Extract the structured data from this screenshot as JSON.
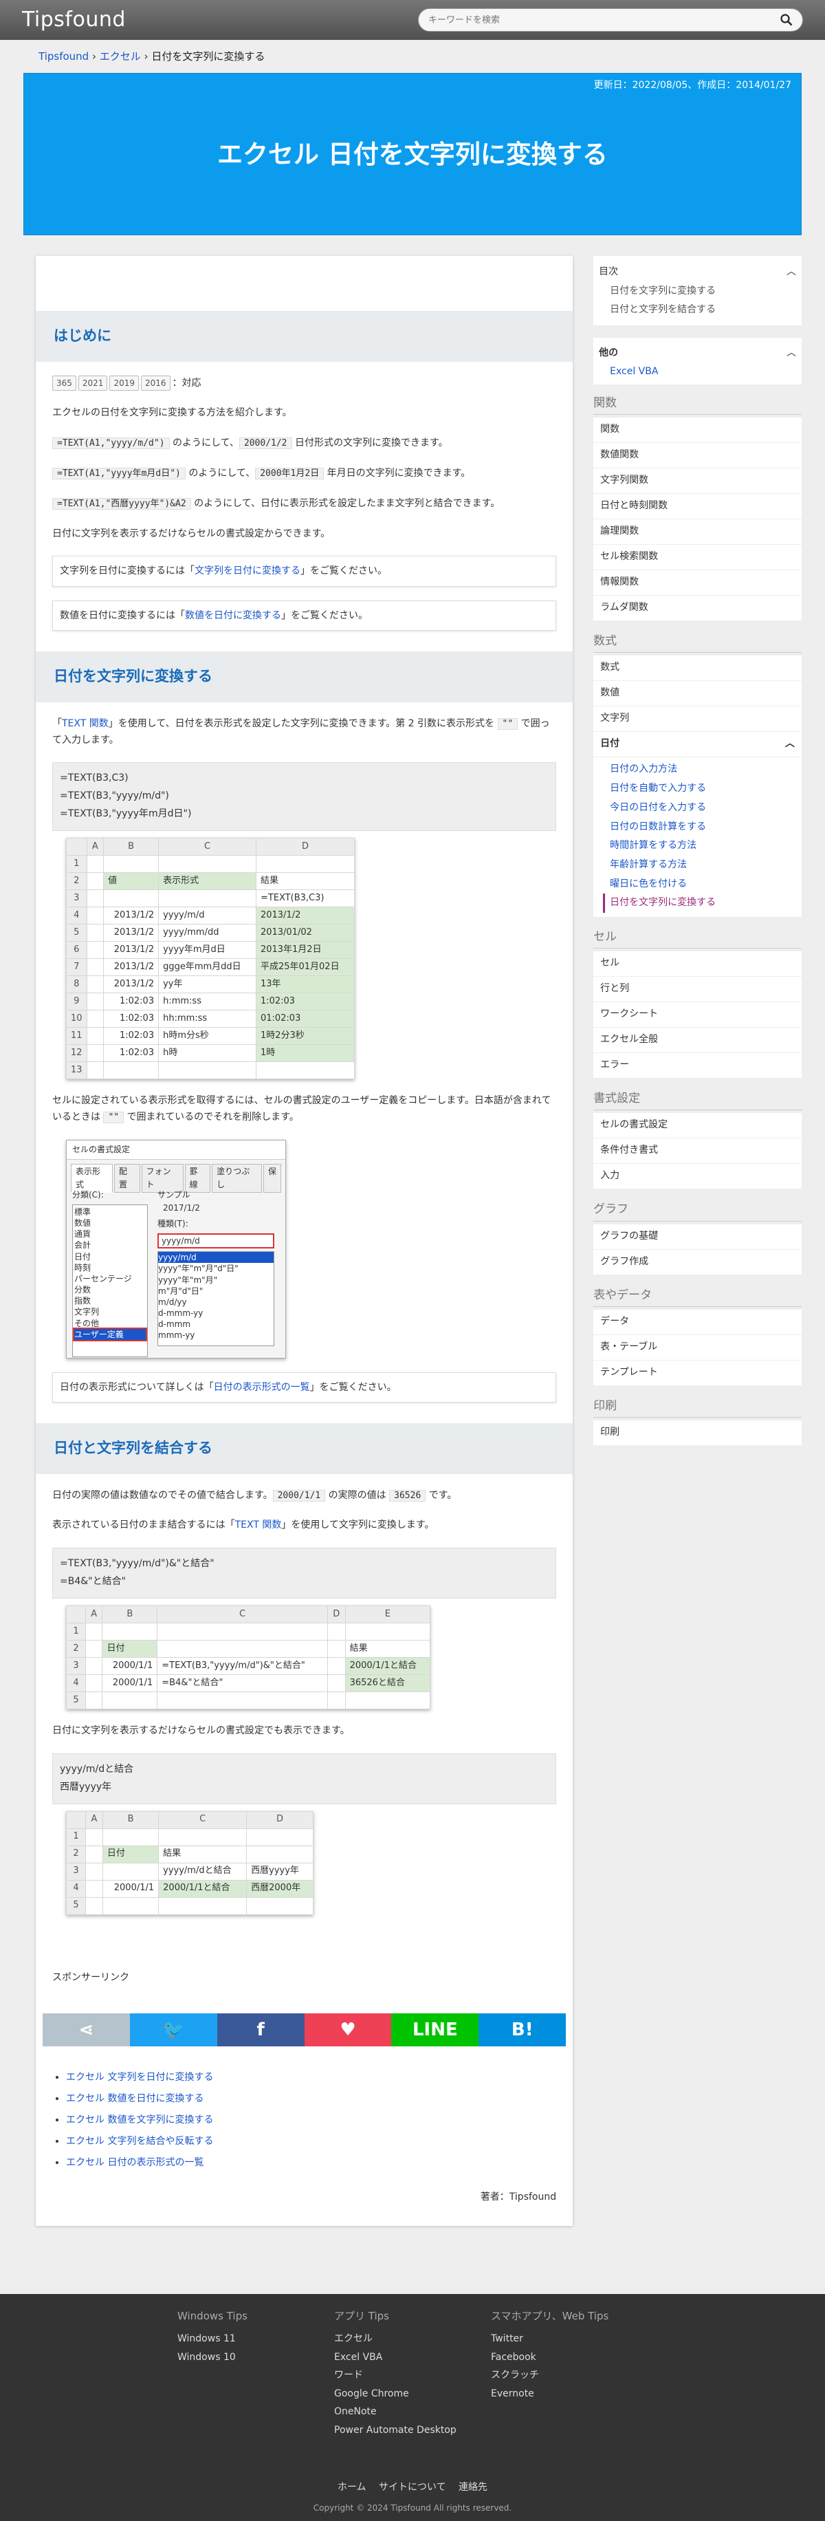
{
  "site": {
    "logo": "Tipsfound",
    "search_placeholder": "キーワードを検索"
  },
  "breadcrumb": [
    "Tipsfound",
    "エクセル",
    "日付を文字列に変換する"
  ],
  "hero": {
    "dates": "更新日：2022/08/05、作成日：2014/01/27",
    "title": "エクセル 日付を文字列に変換する"
  },
  "intro": {
    "heading": "はじめに",
    "versions": [
      "365",
      "2021",
      "2019",
      "2016"
    ],
    "versions_suffix": "：対応",
    "p1": "エクセルの日付を文字列に変換する方法を紹介します。",
    "p2_code": "=TEXT(A1,\"yyyy/m/d\")",
    "p2_mid": " のようにして、",
    "p2_code2": "2000/1/2",
    "p2_end": " 日付形式の文字列に変換できます。",
    "p3_code": "=TEXT(A1,\"yyyy年m月d日\")",
    "p3_mid": " のようにして、",
    "p3_code2": "2000年1月2日",
    "p3_end": " 年月日の文字列に変換できます。",
    "p4_code": "=TEXT(A1,\"西暦yyyy年\")&A2",
    "p4_end": " のようにして、日付に表示形式を設定したまま文字列と結合できます。",
    "p5": "日付に文字列を表示するだけならセルの書式設定からできます。",
    "note1_pre": "文字列を日付に変換するには「",
    "note1_link": "文字列を日付に変換する",
    "note1_post": "」をご覧ください。",
    "note2_pre": "数値を日付に変換するには「",
    "note2_link": "数値を日付に変換する",
    "note2_post": "」をご覧ください。"
  },
  "sec1": {
    "heading": "日付を文字列に変換する",
    "p1_pre": "「",
    "p1_link": "TEXT 関数",
    "p1_post": "」を使用して、日付を表示形式を設定した文字列に変換できます。第 2 引数に表示形式を ",
    "p1_code": "\"\"",
    "p1_end": " で囲って入力します。",
    "code": [
      "=TEXT(B3,C3)",
      "=TEXT(B3,\"yyyy/m/d\")",
      "=TEXT(B3,\"yyyy年m月d日\")"
    ],
    "table": {
      "cols": [
        "",
        "A",
        "B",
        "C",
        "D"
      ],
      "rows": [
        [
          "1",
          "",
          "",
          "",
          ""
        ],
        [
          "2",
          "",
          "値",
          "表示形式",
          "結果"
        ],
        [
          "3",
          "",
          "",
          "",
          "=TEXT(B3,C3)"
        ],
        [
          "4",
          "",
          "2013/1/2",
          "yyyy/m/d",
          "2013/1/2"
        ],
        [
          "5",
          "",
          "2013/1/2",
          "yyyy/mm/dd",
          "2013/01/02"
        ],
        [
          "6",
          "",
          "2013/1/2",
          "yyyy年m月d日",
          "2013年1月2日"
        ],
        [
          "7",
          "",
          "2013/1/2",
          "ggge年mm月dd日",
          "平成25年01月02日"
        ],
        [
          "8",
          "",
          "2013/1/2",
          "yy年",
          "13年"
        ],
        [
          "9",
          "",
          "1:02:03",
          "h:mm:ss",
          "1:02:03"
        ],
        [
          "10",
          "",
          "1:02:03",
          "hh:mm:ss",
          "01:02:03"
        ],
        [
          "11",
          "",
          "1:02:03",
          "h時m分s秒",
          "1時2分3秒"
        ],
        [
          "12",
          "",
          "1:02:03",
          "h時",
          "1時"
        ],
        [
          "13",
          "",
          "",
          "",
          ""
        ]
      ]
    },
    "p2_a": "セルに設定されている表示形式を取得するには、セルの書式設定のユーザー定義をコピーします。日本語が含まれているときは ",
    "p2_code": "\"\"",
    "p2_b": " で囲まれているのでそれを削除します。",
    "dialog": {
      "title": "セルの書式設定",
      "tabs": [
        "表示形式",
        "配置",
        "フォント",
        "罫線",
        "塗りつぶし",
        "保"
      ],
      "cat_label": "分類(C):",
      "cats": [
        "標準",
        "数値",
        "通貨",
        "会計",
        "日付",
        "時刻",
        "パーセンテージ",
        "分数",
        "指数",
        "文字列",
        "その他",
        "ユーザー定義"
      ],
      "sample_label": "サンプル",
      "sample": "2017/1/2",
      "type_label": "種類(T):",
      "type_value": "yyyy/m/d",
      "types": [
        "yyyy/m/d",
        "yyyy\"年\"m\"月\"d\"日\"",
        "yyyy\"年\"m\"月\"",
        "m\"月\"d\"日\"",
        "m/d/yy",
        "d-mmm-yy",
        "d-mmm",
        "mmm-yy"
      ]
    },
    "note_pre": "日付の表示形式について詳しくは「",
    "note_link": "日付の表示形式の一覧",
    "note_post": "」をご覧ください。"
  },
  "sec2": {
    "heading": "日付と文字列を結合する",
    "p1_pre": "日付の実際の値は数値なのでその値で結合します。",
    "p1_code": "2000/1/1",
    "p1_mid": " の実際の値は ",
    "p1_code2": "36526",
    "p1_end": " です。",
    "p2_pre": "表示されている日付のまま結合するには「",
    "p2_link": "TEXT 関数",
    "p2_post": "」を使用して文字列に変換します。",
    "code": [
      "=TEXT(B3,\"yyyy/m/d\")&\"と結合\"",
      "=B4&\"と結合\""
    ],
    "table": {
      "cols": [
        "",
        "A",
        "B",
        "C",
        "D",
        "E"
      ],
      "rows": [
        [
          "1",
          "",
          "",
          "",
          "",
          ""
        ],
        [
          "2",
          "",
          "日付",
          "",
          "",
          "結果"
        ],
        [
          "3",
          "",
          "2000/1/1",
          "=TEXT(B3,\"yyyy/m/d\")&\"と結合\"",
          "",
          "2000/1/1と結合"
        ],
        [
          "4",
          "",
          "2000/1/1",
          "=B4&\"と結合\"",
          "",
          "36526と結合"
        ],
        [
          "5",
          "",
          "",
          "",
          "",
          ""
        ]
      ]
    },
    "p3": "日付に文字列を表示するだけならセルの書式設定でも表示できます。",
    "code2": [
      "yyyy/m/dと結合",
      "西暦yyyy年"
    ],
    "table2": {
      "cols": [
        "",
        "A",
        "B",
        "C",
        "D"
      ],
      "rows": [
        [
          "1",
          "",
          "",
          "",
          ""
        ],
        [
          "2",
          "",
          "日付",
          "結果",
          ""
        ],
        [
          "3",
          "",
          "",
          "yyyy/m/dと結合",
          "西暦yyyy年"
        ],
        [
          "4",
          "",
          "2000/1/1",
          "2000/1/1と結合",
          "西暦2000年"
        ],
        [
          "5",
          "",
          "",
          "",
          ""
        ]
      ]
    }
  },
  "sponsor": "スポンサーリンク",
  "sns": [
    {
      "name": "share",
      "label": "⋖",
      "color": "#b5c3cd"
    },
    {
      "name": "twitter",
      "label": "🐦",
      "color": "#1da1f2"
    },
    {
      "name": "facebook",
      "label": "f",
      "color": "#3b5998"
    },
    {
      "name": "pocket",
      "label": "♥",
      "color": "#ef4056"
    },
    {
      "name": "line",
      "label": "LINE",
      "color": "#00c300"
    },
    {
      "name": "hatena",
      "label": "B!",
      "color": "#008fde"
    }
  ],
  "related": [
    "エクセル 文字列を日付に変換する",
    "エクセル 数値を日付に変換する",
    "エクセル 数値を文字列に変換する",
    "エクセル 文字列を結合や反転する",
    "エクセル 日付の表示形式の一覧"
  ],
  "author": "著者：Tipsfound",
  "sidebar": {
    "toc_title": "目次",
    "toc": [
      "日付を文字列に変換する",
      "日付と文字列を結合する"
    ],
    "other_title": "他の",
    "other": [
      "Excel VBA"
    ],
    "groups": [
      {
        "title": "関数",
        "items": [
          "関数",
          "数値関数",
          "文字列関数",
          "日付と時刻関数",
          "論理関数",
          "セル検索関数",
          "情報関数",
          "ラムダ関数"
        ]
      },
      {
        "title": "数式",
        "items": [
          "数式",
          "数値",
          "文字列",
          "日付"
        ],
        "sub": [
          "日付の入力方法",
          "日付を自動で入力する",
          "今日の日付を入力する",
          "日付の日数計算をする",
          "時間計算をする方法",
          "年齢計算する方法",
          "曜日に色を付ける",
          "日付を文字列に変換する"
        ]
      },
      {
        "title": "セル",
        "items": [
          "セル",
          "行と列",
          "ワークシート",
          "エクセル全般",
          "エラー"
        ]
      },
      {
        "title": "書式設定",
        "items": [
          "セルの書式設定",
          "条件付き書式",
          "入力"
        ]
      },
      {
        "title": "グラフ",
        "items": [
          "グラフの基礎",
          "グラフ作成"
        ]
      },
      {
        "title": "表やデータ",
        "items": [
          "データ",
          "表・テーブル",
          "テンプレート"
        ]
      },
      {
        "title": "印刷",
        "items": [
          "印刷"
        ]
      }
    ]
  },
  "footer": {
    "cols": [
      {
        "title": "Windows Tips",
        "items": [
          "Windows 11",
          "Windows 10"
        ]
      },
      {
        "title": "アプリ Tips",
        "items": [
          "エクセル",
          "Excel VBA",
          "ワード",
          "Google Chrome",
          "OneNote",
          "Power Automate Desktop"
        ]
      },
      {
        "title": "スマホアプリ、Web Tips",
        "items": [
          "Twitter",
          "Facebook",
          "スクラッチ",
          "Evernote"
        ]
      }
    ],
    "links": [
      "ホーム",
      "サイトについて",
      "連絡先"
    ],
    "copyright": "Copyright © 2024 Tipsfound All rights reserved."
  }
}
